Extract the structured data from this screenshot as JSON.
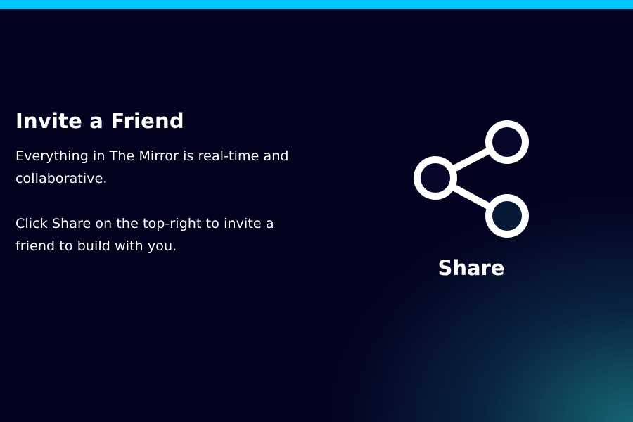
{
  "accent_color": "#00c8ff",
  "background_color": "#03021f",
  "invite": {
    "title": "Invite a Friend",
    "paragraph_1": "Everything in The Mirror is real-time and collaborative.",
    "paragraph_2": "Click Share on the top-right to invite a friend to build with you."
  },
  "share_illustration": {
    "icon": "share-icon",
    "label": "Share"
  }
}
